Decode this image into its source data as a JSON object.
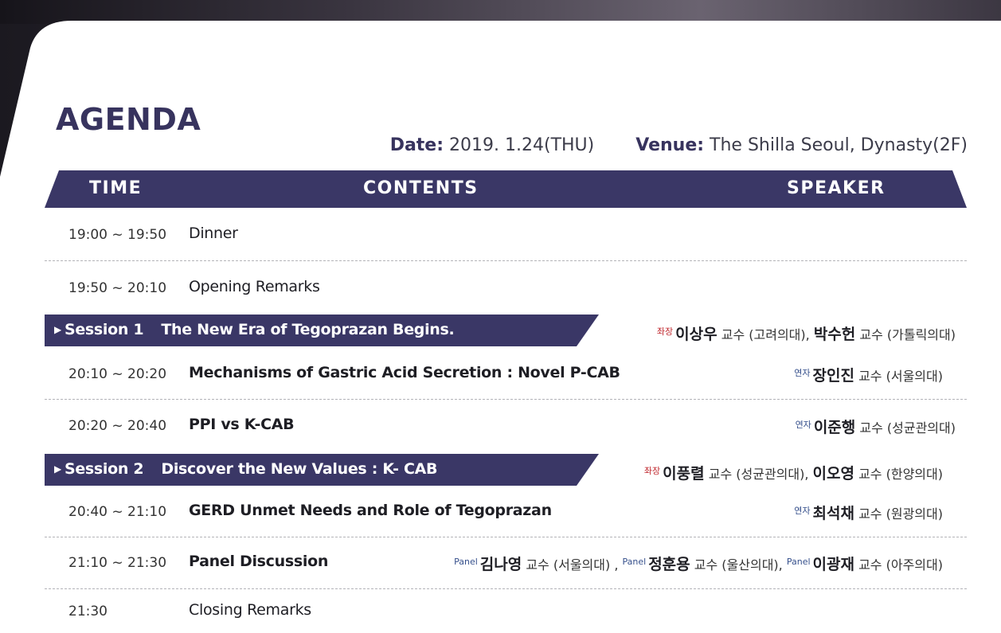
{
  "title": "AGENDA",
  "date": {
    "label": "Date:",
    "value": "2019. 1.24(THU)"
  },
  "venue": {
    "label": "Venue:",
    "value": "The Shilla Seoul, Dynasty(2F)"
  },
  "columns": {
    "time": "TIME",
    "contents": "CONTENTS",
    "speaker": "SPEAKER"
  },
  "roles": {
    "chair": "좌장",
    "speaker": "연자",
    "panel": "Panel"
  },
  "title_suffix": "교수",
  "rows": {
    "dinner": {
      "time": "19:00 ~ 19:50",
      "content": "Dinner"
    },
    "opening": {
      "time": "19:50 ~ 20:10",
      "content": "Opening Remarks"
    },
    "mechanisms": {
      "time": "20:10 ~ 20:20",
      "content": "Mechanisms of Gastric Acid Secretion : Novel P-CAB",
      "speaker_name": "장인진",
      "speaker_aff": "(서울의대)"
    },
    "ppi": {
      "time": "20:20 ~ 20:40",
      "content": "PPI vs K-CAB",
      "speaker_name": "이준행",
      "speaker_aff": "(성균관의대)"
    },
    "gerd": {
      "time": "20:40 ~ 21:10",
      "content": "GERD Unmet Needs and Role of Tegoprazan",
      "speaker_name": "최석채",
      "speaker_aff": "(원광의대)"
    },
    "panel": {
      "time": "21:10 ~ 21:30",
      "content": "Panel Discussion",
      "panelists": [
        {
          "name": "김나영",
          "aff": "(서울의대)",
          "sep": " ,"
        },
        {
          "name": "정훈용",
          "aff": "(울산의대),",
          "sep": ""
        },
        {
          "name": "이광재",
          "aff": "(아주의대)",
          "sep": ""
        }
      ]
    },
    "closing": {
      "time": "21:30",
      "content": "Closing Remarks"
    }
  },
  "sessions": [
    {
      "number": "Session 1",
      "title": "The New Era of Tegoprazan Begins.",
      "chairs": [
        {
          "name": "이상우",
          "aff": "(고려의대),"
        },
        {
          "name": "박수헌",
          "aff": "(가톨릭의대)"
        }
      ]
    },
    {
      "number": "Session 2",
      "title": "Discover the New Values : K- CAB",
      "chairs": [
        {
          "name": "이풍렬",
          "aff": "(성균관의대),"
        },
        {
          "name": "이오영",
          "aff": "(한양의대)"
        }
      ]
    }
  ],
  "colors": {
    "navy": "#37335e",
    "bar": "#3a3766",
    "chair_red": "#c0282e",
    "role_blue": "#36508c"
  }
}
